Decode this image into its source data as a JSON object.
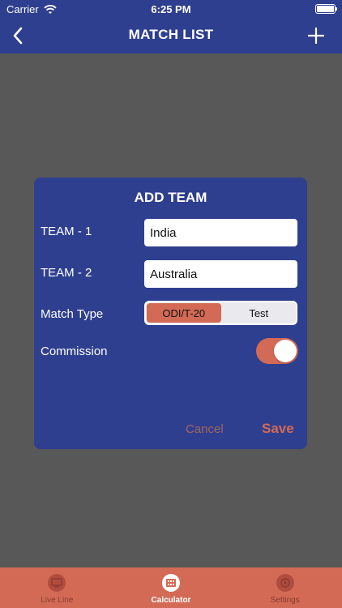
{
  "status_bar": {
    "carrier": "Carrier",
    "time": "6:25 PM"
  },
  "navbar": {
    "title": "MATCH LIST",
    "back_icon": "chevron-left-icon",
    "add_icon": "plus-icon"
  },
  "modal": {
    "title": "ADD TEAM",
    "team1_label": "TEAM - 1",
    "team1_value": "India",
    "team2_label": "TEAM - 2",
    "team2_value": "Australia",
    "match_type_label": "Match Type",
    "match_type_options": [
      "ODI/T-20",
      "Test"
    ],
    "match_type_selected": "ODI/T-20",
    "commission_label": "Commission",
    "commission_on": true,
    "cancel_label": "Cancel",
    "save_label": "Save"
  },
  "tabbar": {
    "items": [
      {
        "label": "Live Line",
        "icon": "tv-icon",
        "active": false
      },
      {
        "label": "Calculator",
        "icon": "calculator-icon",
        "active": true
      },
      {
        "label": "Settings",
        "icon": "settings-icon",
        "active": false
      }
    ]
  },
  "colors": {
    "primary": "#2f3f8f",
    "accent": "#d36a55",
    "overlay": "#585858"
  }
}
